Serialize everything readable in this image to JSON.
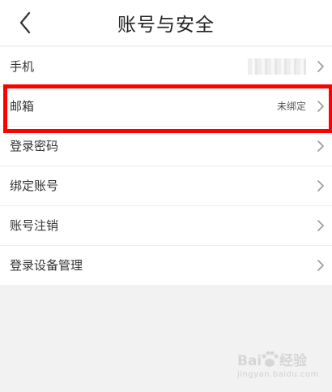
{
  "header": {
    "title": "账号与安全"
  },
  "rows": [
    {
      "label": "手机",
      "value": ""
    },
    {
      "label": "邮箱",
      "value": "未绑定"
    },
    {
      "label": "登录密码",
      "value": ""
    },
    {
      "label": "绑定账号",
      "value": ""
    },
    {
      "label": "账号注销",
      "value": ""
    },
    {
      "label": "登录设备管理",
      "value": ""
    }
  ],
  "watermark": {
    "logo_text": "Baidu经验",
    "url": "jingyan.baidu.com"
  },
  "colors": {
    "highlight": "#ff0000",
    "background": "#f2f2f2",
    "surface": "#ffffff"
  },
  "icons": [
    "back-arrow-icon",
    "chevron-right-icon",
    "baidu-paw-icon"
  ]
}
